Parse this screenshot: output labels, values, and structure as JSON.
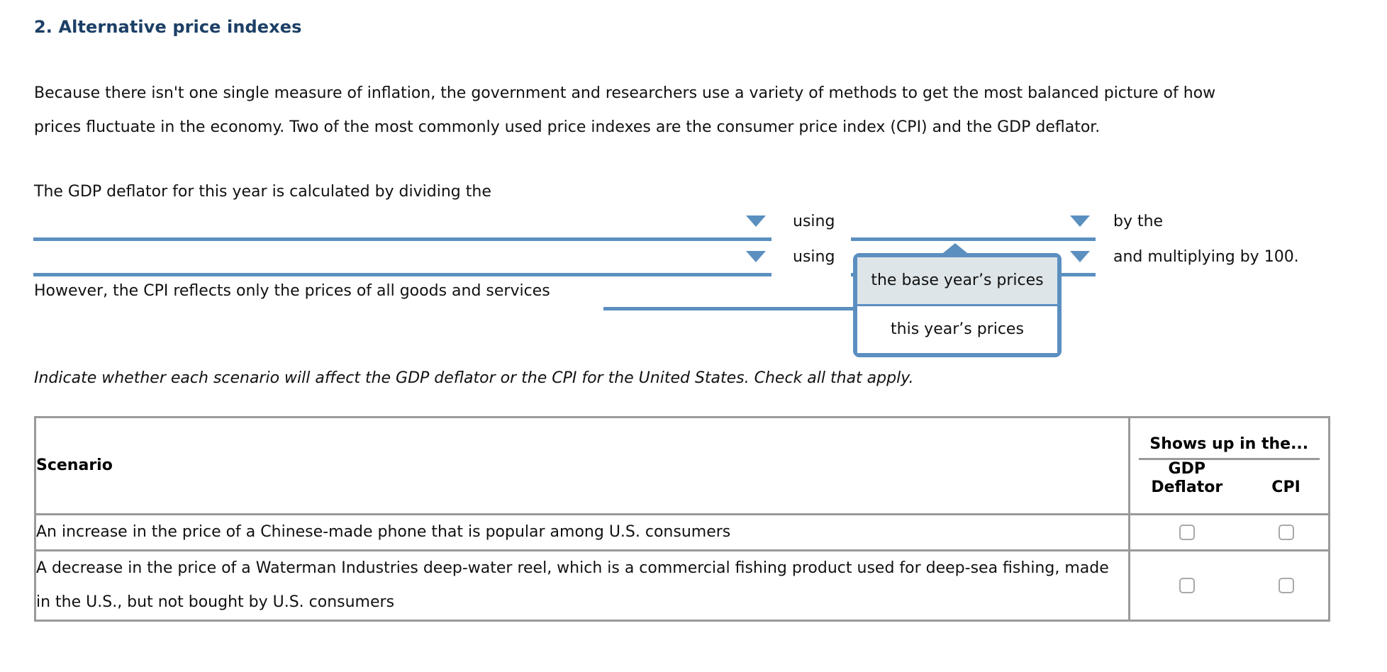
{
  "heading": "2. Alternative price indexes",
  "intro": {
    "line1": "Because there isn't one single measure of inflation, the government and researchers use a variety of methods to get the most balanced picture of how",
    "line2": "prices fluctuate in the economy. Two of the most commonly used price indexes are the consumer price index (CPI) and the GDP deflator."
  },
  "statement": {
    "lead": "The GDP deflator for this year is calculated by dividing the",
    "using_1": "using",
    "by_the": "by the",
    "using_2": "using",
    "and_multiplying": "and multiplying by 100.",
    "however": "However, the CPI reflects only the prices of all goods and services"
  },
  "dropdowns": {
    "blank_1": "",
    "blank_2": "",
    "blank_3": "",
    "blank_4": "",
    "blank_5": ""
  },
  "popup": {
    "options": [
      {
        "label": "the base year’s prices",
        "selected": true
      },
      {
        "label": "this year’s prices",
        "selected": false
      }
    ]
  },
  "instruction": "Indicate whether each scenario will affect the GDP deflator or the CPI for the United States. Check all that apply.",
  "table": {
    "scenario_header": "Scenario",
    "group_header": "Shows up in the...",
    "sub_headers": [
      "GDP Deflator",
      "CPI"
    ],
    "rows": [
      {
        "scenario": "An increase in the price of a Chinese-made phone that is popular among U.S. consumers",
        "gdp_checked": false,
        "cpi_checked": false
      },
      {
        "scenario": "A decrease in the price of a Waterman Industries deep-water reel, which is a commercial fishing product used for deep-sea fishing, made in the U.S., but not bought by U.S. consumers",
        "gdp_checked": false,
        "cpi_checked": false
      }
    ]
  },
  "colors": {
    "heading": "#1c3f66",
    "accent_blue": "#5b8fc0",
    "popup_selected_bg": "#dde5e8",
    "table_border": "#9a9a9a"
  }
}
